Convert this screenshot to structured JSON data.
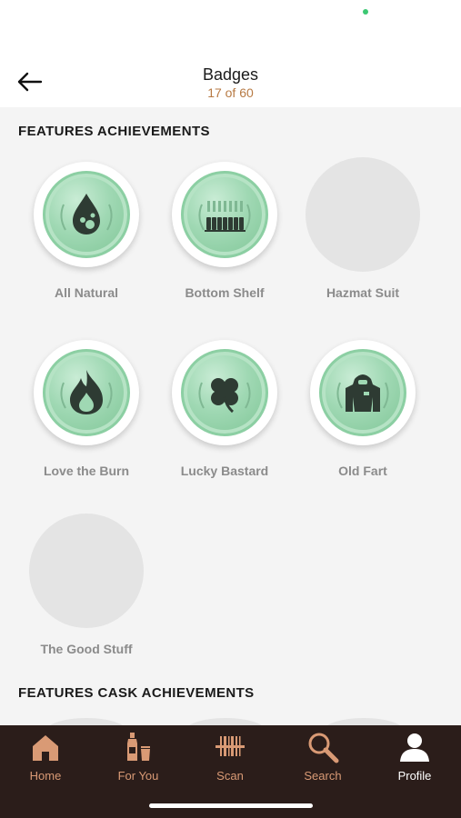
{
  "header": {
    "title": "Badges",
    "subtitle": "17 of 60",
    "back_icon": "arrow-left-icon"
  },
  "sections": [
    {
      "title": "FEATURES ACHIEVEMENTS",
      "badges": [
        {
          "label": "All Natural",
          "earned": true,
          "icon": "water-drop-icon"
        },
        {
          "label": "Bottom Shelf",
          "earned": true,
          "icon": "bottles-icon"
        },
        {
          "label": "Hazmat Suit",
          "earned": false,
          "icon": ""
        },
        {
          "label": "Love the Burn",
          "earned": true,
          "icon": "flame-icon"
        },
        {
          "label": "Lucky Bastard",
          "earned": true,
          "icon": "clover-icon"
        },
        {
          "label": "Old Fart",
          "earned": true,
          "icon": "hazmat-suit-icon"
        },
        {
          "label": "The Good Stuff",
          "earned": false,
          "icon": ""
        }
      ]
    },
    {
      "title": "FEATURES CASK ACHIEVEMENTS",
      "badges": []
    }
  ],
  "tabbar": {
    "items": [
      {
        "label": "Home",
        "icon": "home-icon",
        "active": false
      },
      {
        "label": "For You",
        "icon": "bottle-glass-icon",
        "active": false
      },
      {
        "label": "Scan",
        "icon": "barcode-scan-icon",
        "active": false
      },
      {
        "label": "Search",
        "icon": "search-icon",
        "active": false
      },
      {
        "label": "Profile",
        "icon": "profile-icon",
        "active": true
      }
    ]
  },
  "colors": {
    "accent": "#b77a44",
    "tab_bar_bg": "#2b1d1a",
    "tab_inactive": "#d99a75",
    "badge_green": "#9fd8b3",
    "badge_locked": "#e4e4e4"
  }
}
